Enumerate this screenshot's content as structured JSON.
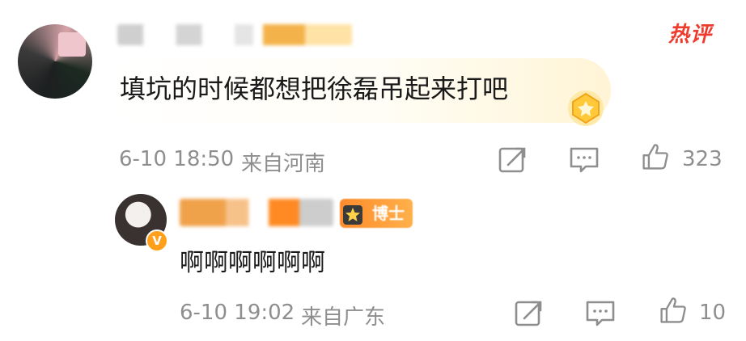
{
  "hot_badge": "热评",
  "main_comment": {
    "text": "填坑的时候都想把徐磊吊起来打吧",
    "date": "6-10 18:50",
    "location": "来自河南",
    "likes": "323"
  },
  "reply": {
    "text": "啊啊啊啊啊啊",
    "badge_label": "博士",
    "date": "6-10 19:02",
    "location": "来自广东",
    "likes": "10"
  },
  "colors": {
    "hot": "#ef3b2d",
    "meta_gray": "#8e8e8e",
    "verified": "#ff9f1a",
    "badge_orange": "#ff8b2c"
  },
  "icons": {
    "share": "share-icon",
    "comment": "comment-icon",
    "like": "like-icon",
    "medal": "medal-icon",
    "verified": "verified-v-icon"
  }
}
